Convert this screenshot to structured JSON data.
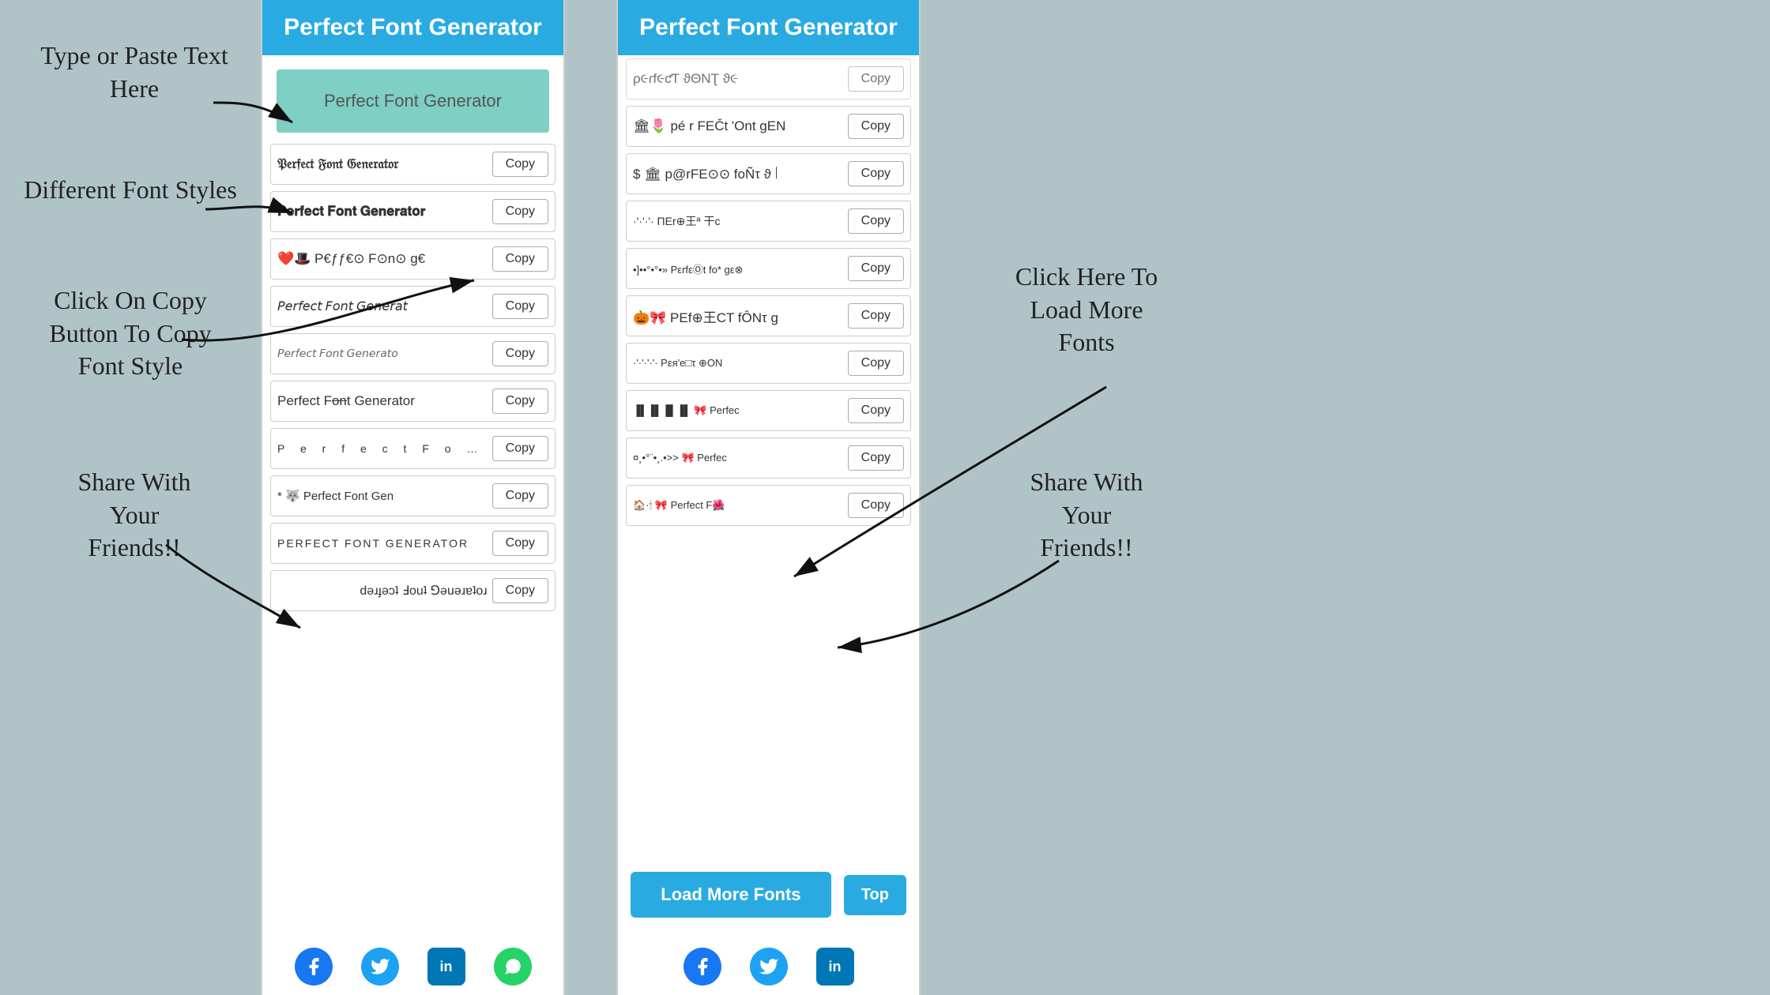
{
  "annotations": {
    "type_paste": "Type or Paste Text\nHere",
    "font_styles": "Different Font\nStyles",
    "click_copy": "Click On Copy\nButton To Copy\nFont Style",
    "share_left": "Share With\nYour\nFriends!!",
    "click_load": "Click Here To\nLoad More\nFonts",
    "share_right": "Share With\nYour\nFriends!!"
  },
  "header": {
    "title": "Perfect Font Generator"
  },
  "input": {
    "value": "Perfect Font Generator"
  },
  "left_panel": {
    "fonts": [
      {
        "text": "𝔓𝔢𝔯𝔣𝔢𝔠𝔱 𝔉𝔬𝔫𝔱 𝔊𝔢𝔫𝔢𝔯𝔞𝔱𝔬𝔯",
        "style": "font-fraktur",
        "copy": "Copy"
      },
      {
        "text": "𝐏𝐞𝐫𝐟𝐞𝐜𝐭 𝐅𝐨𝐧𝐭 𝐆𝐞𝐧𝐞𝐫𝐚𝐭𝐨𝐫",
        "style": "font-bold",
        "copy": "Copy"
      },
      {
        "text": "❤️🎩 P€ƒƒ€⊙ F⊙n⊙ g€",
        "style": "",
        "copy": "Copy"
      },
      {
        "text": "𝘗𝘦𝘳𝘧𝘦𝘤𝘵 𝘍𝘰𝘯𝘵 𝘎𝘦𝘯𝘦𝘳𝘢𝘵",
        "style": "font-italic",
        "copy": "Copy"
      },
      {
        "text": "𝘗𝘦𝘳𝘧𝘦𝘤𝘵 𝘍𝘰𝘯𝘵 𝘎𝘦𝘯𝘦𝘳𝘢𝘵𝘰",
        "style": "font-small",
        "copy": "Copy"
      },
      {
        "text": "Perfect Font Generator",
        "style": "",
        "copy": "Copy"
      },
      {
        "text": "P e r f e c t  F o n t",
        "style": "font-wide",
        "copy": "Copy"
      },
      {
        "text": "* 🐺 Perfect Font Gen",
        "style": "",
        "copy": "Copy"
      },
      {
        "text": "PERFECT FONT GENERATOR",
        "style": "font-upper",
        "copy": "Copy"
      },
      {
        "text": "ɹoʇɐɹǝuǝ⅁ ʇuoℲ ʇɔǝɟɹǝd",
        "style": "font-reverse",
        "copy": "Copy"
      }
    ],
    "social": [
      {
        "name": "facebook-icon",
        "class": "fb",
        "symbol": "f"
      },
      {
        "name": "twitter-icon",
        "class": "tw",
        "symbol": "🐦"
      },
      {
        "name": "linkedin-icon",
        "class": "li",
        "symbol": "in"
      },
      {
        "name": "whatsapp-icon",
        "class": "wa",
        "symbol": "●"
      }
    ]
  },
  "right_panel": {
    "partial_top": {
      "text": "ρ૯ɾf૯ƈƬ ϑΘΝƮ ϑ૯",
      "copy": "Copy"
    },
    "fonts": [
      {
        "text": "🏛🌷 pé r FEČt 'Ont gEN",
        "copy": "Copy"
      },
      {
        "text": "$ 🏛 p@rFE⊙⊙ foÑτ ϑ꒐ꖰ",
        "copy": "Copy"
      },
      {
        "text": "·'·'·'·  ΠEr⊕王ª 干c",
        "copy": "Copy"
      },
      {
        "text": "•]••°•°•» PεrfεⓄt fo* gε⊗",
        "copy": "Copy"
      },
      {
        "text": "🎃🎀 PEf⊕王CT fÔNτ g",
        "copy": "Copy"
      },
      {
        "text": "·'·'·'·'· Pεя'e□τ ⊕ON",
        "copy": "Copy"
      },
      {
        "text": "▐▌▐▌▐▌ 🎀 Perfec",
        "copy": "Copy"
      },
      {
        "text": "¤¸•°¨•¸.•>> 🎀 Perfec",
        "copy": "Copy"
      },
      {
        "text": "🏠·🕯 🎀 Perfect F🌺",
        "copy": "Copy"
      }
    ],
    "load_more": "Load More Fonts",
    "top_btn": "Top",
    "social": [
      {
        "name": "facebook-icon",
        "class": "fb",
        "symbol": "f"
      },
      {
        "name": "twitter-icon",
        "class": "tw",
        "symbol": "🐦"
      },
      {
        "name": "linkedin-icon",
        "class": "li",
        "symbol": "in"
      }
    ]
  }
}
